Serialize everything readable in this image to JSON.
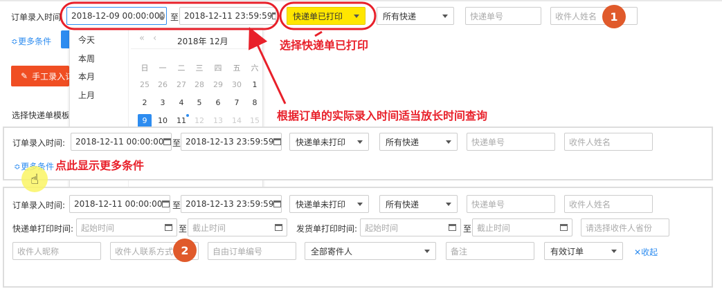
{
  "top": {
    "order_time_label": "订单录入时间",
    "date_from": "2018-12-09 00:00:00",
    "date_to": "2018-12-11 23:59:59",
    "to_sep": "至",
    "print_status": "快递单已打印",
    "express": "所有快递",
    "express_no_placeholder": "快递单号",
    "recipient_placeholder": "收件人姓名",
    "more_conditions": "更多条件",
    "manual_entry_btn": "手工录入订",
    "select_template_label": "选择快递单模板"
  },
  "quick_ranges": [
    "今天",
    "本周",
    "本月",
    "上月"
  ],
  "calendar": {
    "title": "2018年 12月",
    "weekdays": [
      "日",
      "一",
      "二",
      "三",
      "四",
      "五",
      "六"
    ],
    "rows": [
      [
        "25",
        "26",
        "27",
        "28",
        "29",
        "30",
        "1"
      ],
      [
        "2",
        "3",
        "4",
        "5",
        "6",
        "7",
        "8"
      ],
      [
        "9",
        "10",
        "11",
        "12",
        "13",
        "14",
        "15"
      ]
    ],
    "selected_day": "9"
  },
  "panel1": {
    "order_time_label": "订单录入时间:",
    "date_from": "2018-12-11 00:00:00",
    "date_to": "2018-12-13 23:59:59",
    "to_sep": "至",
    "print_status": "快递单未打印",
    "express": "所有快递",
    "express_no_placeholder": "快递单号",
    "recipient_placeholder": "收件人姓名",
    "more_conditions": "更多条件"
  },
  "panel2": {
    "order_time_label": "订单录入时间:",
    "date_from": "2018-12-11 00:00:00",
    "date_to": "2018-12-13 23:59:59",
    "to_sep": "至",
    "print_status": "快递单未打印",
    "express": "所有快递",
    "express_no_placeholder": "快递单号",
    "recipient_placeholder": "收件人姓名",
    "express_print_label": "快递单打印时间:",
    "start_placeholder": "起始时间",
    "end_placeholder": "截止时间",
    "ship_print_label": "发货单打印时间:",
    "province_placeholder": "请选择收件人省份",
    "nickname_placeholder": "收件人昵称",
    "contact_placeholder": "收件人联系方式",
    "custom_order_placeholder": "自由订单编号",
    "sender": "全部寄件人",
    "remark_placeholder": "备注",
    "order_status": "有效订单",
    "collapse": "收起"
  },
  "annotations": {
    "select_printed": "选择快递单已打印",
    "extend_time": "根据订单的实际录入时间适当放长时间查询",
    "show_more": "点此显示更多条件",
    "badge1": "1",
    "badge2": "2"
  },
  "colors": {
    "highlight_yellow": "#ffe600",
    "annotation_red": "#e8202a",
    "badge_orange": "#e05a2b",
    "link_blue": "#2d8cf0"
  }
}
